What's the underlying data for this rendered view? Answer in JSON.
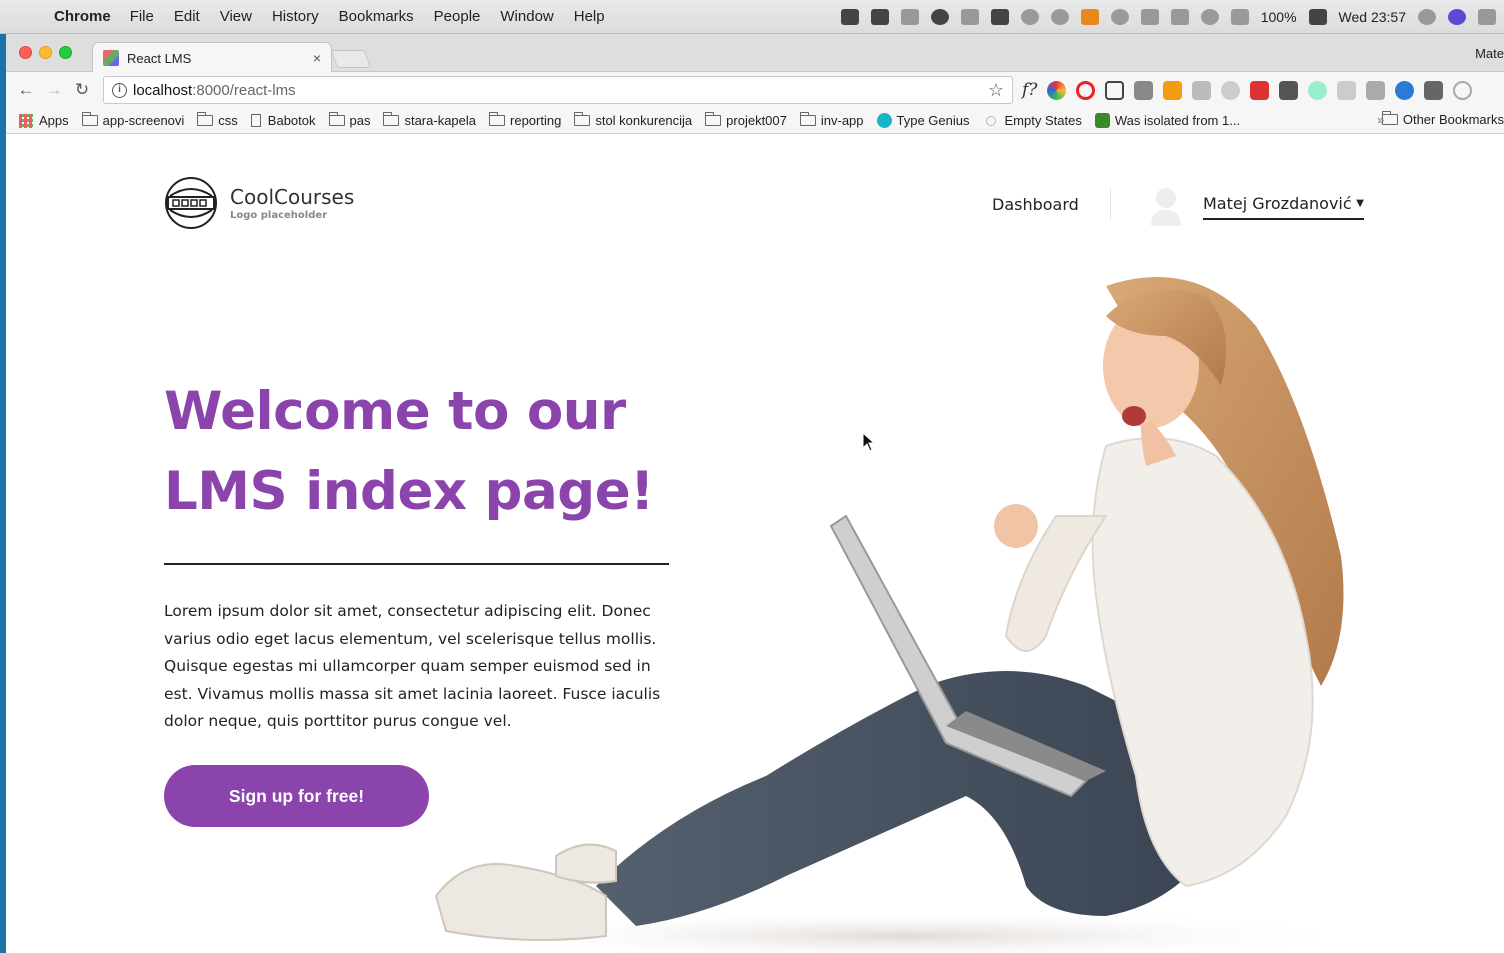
{
  "menubar": {
    "app_name": "Chrome",
    "items": [
      "File",
      "Edit",
      "View",
      "History",
      "Bookmarks",
      "People",
      "Window",
      "Help"
    ],
    "battery": "100%",
    "clock": "Wed 23:57"
  },
  "browser": {
    "tab_title": "React LMS",
    "tab_close": "×",
    "profile_name": "Mate",
    "url_host": "localhost",
    "url_path": ":8000/react-lms",
    "bookmarks": [
      {
        "label": "Apps",
        "icon": "apps-grid-icon"
      },
      {
        "label": "app-screenovi",
        "icon": "folder-icon"
      },
      {
        "label": "css",
        "icon": "folder-icon"
      },
      {
        "label": "Babotok",
        "icon": "page-icon"
      },
      {
        "label": "pas",
        "icon": "folder-icon"
      },
      {
        "label": "stara-kapela",
        "icon": "folder-icon"
      },
      {
        "label": "reporting",
        "icon": "folder-icon"
      },
      {
        "label": "stol konkurencija",
        "icon": "folder-icon"
      },
      {
        "label": "projekt007",
        "icon": "folder-icon"
      },
      {
        "label": "inv-app",
        "icon": "folder-icon"
      },
      {
        "label": "Type Genius",
        "icon": "type-genius-icon"
      },
      {
        "label": "Empty States",
        "icon": "empty-states-icon"
      },
      {
        "label": "Was isolated from 1...",
        "icon": "green-square-icon"
      }
    ],
    "bookmarks_more": "»",
    "other_bookmarks": "Other Bookmarks"
  },
  "site": {
    "logo_title": "CoolCourses",
    "logo_subtitle": "Logo placeholder",
    "nav_dashboard": "Dashboard",
    "user_name": "Matej Grozdanović",
    "hero_title_line1": "Welcome to our",
    "hero_title_line2": "LMS index page!",
    "hero_text": "Lorem ipsum dolor sit amet, consectetur adipiscing elit. Donec varius odio eget lacus elementum, vel scelerisque tellus mollis. Quisque egestas mi ullamcorper quam semper euismod sed in est. Vivamus mollis massa sit amet lacinia laoreet. Fusce iaculis dolor neque, quis porttitor purus congue vel.",
    "cta_label": "Sign up for free!",
    "hero_image_alt": "woman-with-laptop-illustration"
  },
  "colors": {
    "brand_purple": "#8b44ac",
    "text_dark": "#222222"
  }
}
